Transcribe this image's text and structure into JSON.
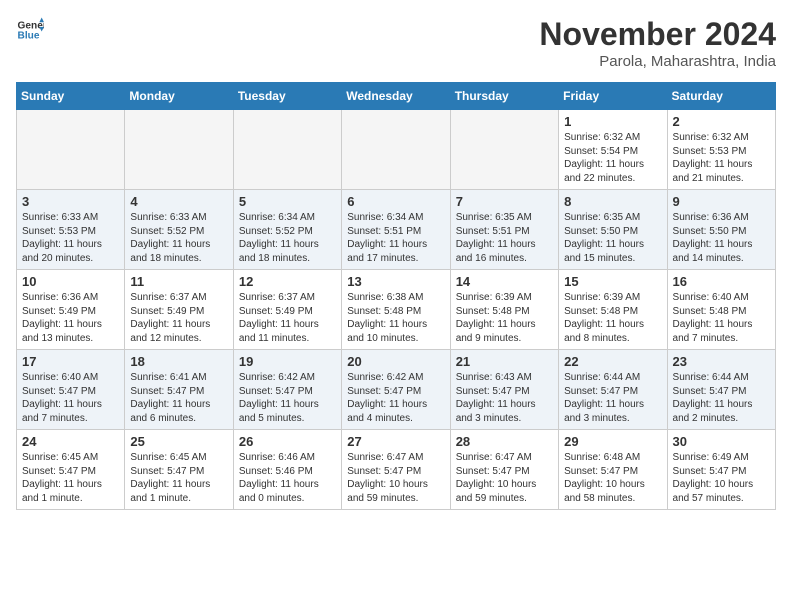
{
  "header": {
    "logo_line1": "General",
    "logo_line2": "Blue",
    "month": "November 2024",
    "location": "Parola, Maharashtra, India"
  },
  "weekdays": [
    "Sunday",
    "Monday",
    "Tuesday",
    "Wednesday",
    "Thursday",
    "Friday",
    "Saturday"
  ],
  "weeks": [
    [
      {
        "day": "",
        "info": "",
        "empty": true
      },
      {
        "day": "",
        "info": "",
        "empty": true
      },
      {
        "day": "",
        "info": "",
        "empty": true
      },
      {
        "day": "",
        "info": "",
        "empty": true
      },
      {
        "day": "",
        "info": "",
        "empty": true
      },
      {
        "day": "1",
        "info": "Sunrise: 6:32 AM\nSunset: 5:54 PM\nDaylight: 11 hours and 22 minutes.",
        "empty": false
      },
      {
        "day": "2",
        "info": "Sunrise: 6:32 AM\nSunset: 5:53 PM\nDaylight: 11 hours and 21 minutes.",
        "empty": false
      }
    ],
    [
      {
        "day": "3",
        "info": "Sunrise: 6:33 AM\nSunset: 5:53 PM\nDaylight: 11 hours and 20 minutes.",
        "empty": false
      },
      {
        "day": "4",
        "info": "Sunrise: 6:33 AM\nSunset: 5:52 PM\nDaylight: 11 hours and 18 minutes.",
        "empty": false
      },
      {
        "day": "5",
        "info": "Sunrise: 6:34 AM\nSunset: 5:52 PM\nDaylight: 11 hours and 18 minutes.",
        "empty": false
      },
      {
        "day": "6",
        "info": "Sunrise: 6:34 AM\nSunset: 5:51 PM\nDaylight: 11 hours and 17 minutes.",
        "empty": false
      },
      {
        "day": "7",
        "info": "Sunrise: 6:35 AM\nSunset: 5:51 PM\nDaylight: 11 hours and 16 minutes.",
        "empty": false
      },
      {
        "day": "8",
        "info": "Sunrise: 6:35 AM\nSunset: 5:50 PM\nDaylight: 11 hours and 15 minutes.",
        "empty": false
      },
      {
        "day": "9",
        "info": "Sunrise: 6:36 AM\nSunset: 5:50 PM\nDaylight: 11 hours and 14 minutes.",
        "empty": false
      }
    ],
    [
      {
        "day": "10",
        "info": "Sunrise: 6:36 AM\nSunset: 5:49 PM\nDaylight: 11 hours and 13 minutes.",
        "empty": false
      },
      {
        "day": "11",
        "info": "Sunrise: 6:37 AM\nSunset: 5:49 PM\nDaylight: 11 hours and 12 minutes.",
        "empty": false
      },
      {
        "day": "12",
        "info": "Sunrise: 6:37 AM\nSunset: 5:49 PM\nDaylight: 11 hours and 11 minutes.",
        "empty": false
      },
      {
        "day": "13",
        "info": "Sunrise: 6:38 AM\nSunset: 5:48 PM\nDaylight: 11 hours and 10 minutes.",
        "empty": false
      },
      {
        "day": "14",
        "info": "Sunrise: 6:39 AM\nSunset: 5:48 PM\nDaylight: 11 hours and 9 minutes.",
        "empty": false
      },
      {
        "day": "15",
        "info": "Sunrise: 6:39 AM\nSunset: 5:48 PM\nDaylight: 11 hours and 8 minutes.",
        "empty": false
      },
      {
        "day": "16",
        "info": "Sunrise: 6:40 AM\nSunset: 5:48 PM\nDaylight: 11 hours and 7 minutes.",
        "empty": false
      }
    ],
    [
      {
        "day": "17",
        "info": "Sunrise: 6:40 AM\nSunset: 5:47 PM\nDaylight: 11 hours and 7 minutes.",
        "empty": false
      },
      {
        "day": "18",
        "info": "Sunrise: 6:41 AM\nSunset: 5:47 PM\nDaylight: 11 hours and 6 minutes.",
        "empty": false
      },
      {
        "day": "19",
        "info": "Sunrise: 6:42 AM\nSunset: 5:47 PM\nDaylight: 11 hours and 5 minutes.",
        "empty": false
      },
      {
        "day": "20",
        "info": "Sunrise: 6:42 AM\nSunset: 5:47 PM\nDaylight: 11 hours and 4 minutes.",
        "empty": false
      },
      {
        "day": "21",
        "info": "Sunrise: 6:43 AM\nSunset: 5:47 PM\nDaylight: 11 hours and 3 minutes.",
        "empty": false
      },
      {
        "day": "22",
        "info": "Sunrise: 6:44 AM\nSunset: 5:47 PM\nDaylight: 11 hours and 3 minutes.",
        "empty": false
      },
      {
        "day": "23",
        "info": "Sunrise: 6:44 AM\nSunset: 5:47 PM\nDaylight: 11 hours and 2 minutes.",
        "empty": false
      }
    ],
    [
      {
        "day": "24",
        "info": "Sunrise: 6:45 AM\nSunset: 5:47 PM\nDaylight: 11 hours and 1 minute.",
        "empty": false
      },
      {
        "day": "25",
        "info": "Sunrise: 6:45 AM\nSunset: 5:47 PM\nDaylight: 11 hours and 1 minute.",
        "empty": false
      },
      {
        "day": "26",
        "info": "Sunrise: 6:46 AM\nSunset: 5:46 PM\nDaylight: 11 hours and 0 minutes.",
        "empty": false
      },
      {
        "day": "27",
        "info": "Sunrise: 6:47 AM\nSunset: 5:47 PM\nDaylight: 10 hours and 59 minutes.",
        "empty": false
      },
      {
        "day": "28",
        "info": "Sunrise: 6:47 AM\nSunset: 5:47 PM\nDaylight: 10 hours and 59 minutes.",
        "empty": false
      },
      {
        "day": "29",
        "info": "Sunrise: 6:48 AM\nSunset: 5:47 PM\nDaylight: 10 hours and 58 minutes.",
        "empty": false
      },
      {
        "day": "30",
        "info": "Sunrise: 6:49 AM\nSunset: 5:47 PM\nDaylight: 10 hours and 57 minutes.",
        "empty": false
      }
    ]
  ]
}
